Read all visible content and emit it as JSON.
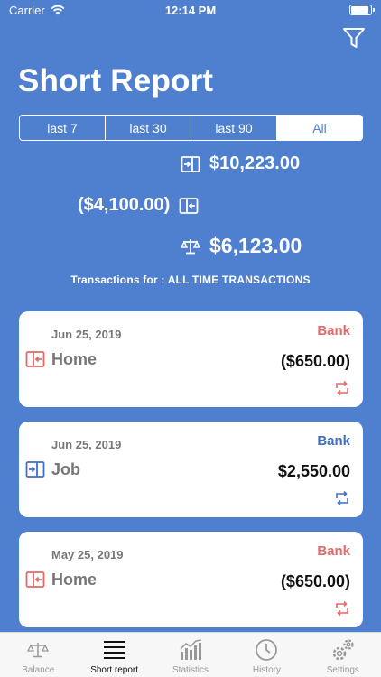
{
  "status_bar": {
    "carrier": "Carrier",
    "time": "12:14 PM"
  },
  "header": {
    "title": "Short Report"
  },
  "segments": [
    {
      "label": "last 7",
      "active": false
    },
    {
      "label": "last 30",
      "active": false
    },
    {
      "label": "last 90",
      "active": false
    },
    {
      "label": "All",
      "active": true
    }
  ],
  "summary": {
    "income": "$10,223.00",
    "expense": "($4,100.00)",
    "balance": "$6,123.00"
  },
  "transactions_caption": "Transactions for : ALL TIME TRANSACTIONS",
  "transactions": [
    {
      "date": "Jun 25, 2019",
      "source": "Bank",
      "category": "Home",
      "amount": "($650.00)",
      "type": "expense"
    },
    {
      "date": "Jun 25, 2019",
      "source": "Bank",
      "category": "Job",
      "amount": "$2,550.00",
      "type": "income"
    },
    {
      "date": "May 25, 2019",
      "source": "Bank",
      "category": "Home",
      "amount": "($650.00)",
      "type": "expense"
    }
  ],
  "tabs": [
    {
      "label": "Balance",
      "icon": "scale-icon",
      "active": false
    },
    {
      "label": "Short report",
      "icon": "list-icon",
      "active": true
    },
    {
      "label": "Statistics",
      "icon": "bar-chart-icon",
      "active": false
    },
    {
      "label": "History",
      "icon": "clock-icon",
      "active": false
    },
    {
      "label": "Settings",
      "icon": "gears-icon",
      "active": false
    }
  ],
  "colors": {
    "background": "#4f7fcf",
    "expense": "#e06a6a",
    "income": "#3f6fc4"
  }
}
